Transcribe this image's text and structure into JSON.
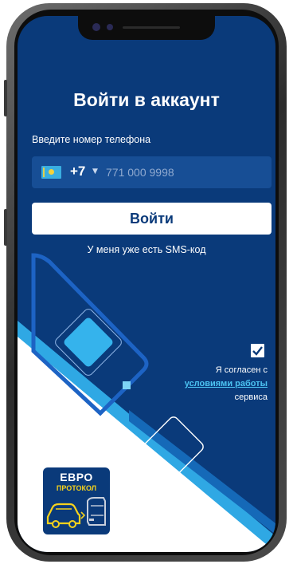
{
  "login": {
    "title": "Войти в аккаунт",
    "phone_label": "Введите номер телефона",
    "country_code": "+7",
    "country_flag": "kazakhstan-flag-icon",
    "phone_placeholder": "771 000 9998",
    "submit_label": "Войти",
    "sms_link": "У меня уже есть SMS-код"
  },
  "consent": {
    "checked": true,
    "line1": "Я согласен с",
    "terms_link": "условиями работы",
    "line3": "сервиса"
  },
  "logo": {
    "line1": "ЕВРО",
    "line2": "ПРОТОКОЛ",
    "icon": "collision-cars-icon"
  },
  "colors": {
    "background": "#0a3a7a",
    "field": "#174e95",
    "accent": "#4cc3f2",
    "logo_yellow": "#f6d21c"
  }
}
